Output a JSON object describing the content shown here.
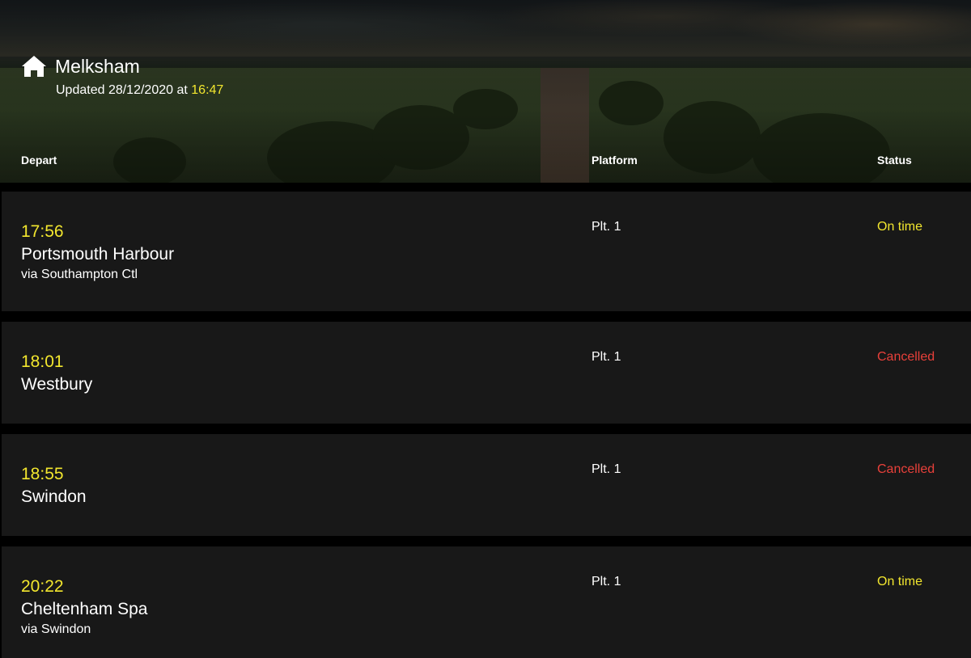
{
  "header": {
    "station": "Melksham",
    "updated_prefix": "Updated 28/12/2020 at",
    "updated_time": "16:47",
    "columns": {
      "depart": "Depart",
      "platform": "Platform",
      "status": "Status"
    }
  },
  "colors": {
    "accent_yellow": "#f2e62e",
    "cancelled_red": "#e8403a",
    "row_background": "#181818"
  },
  "departures": [
    {
      "time": "17:56",
      "destination": "Portsmouth Harbour",
      "via": "via Southampton Ctl",
      "platform": "Plt. 1",
      "status": "On time",
      "status_color": "#f2e62e"
    },
    {
      "time": "18:01",
      "destination": "Westbury",
      "via": "",
      "platform": "Plt. 1",
      "status": "Cancelled",
      "status_color": "#e8403a"
    },
    {
      "time": "18:55",
      "destination": "Swindon",
      "via": "",
      "platform": "Plt. 1",
      "status": "Cancelled",
      "status_color": "#e8403a"
    },
    {
      "time": "20:22",
      "destination": "Cheltenham Spa",
      "via": "via Swindon",
      "platform": "Plt. 1",
      "status": "On time",
      "status_color": "#f2e62e"
    }
  ]
}
